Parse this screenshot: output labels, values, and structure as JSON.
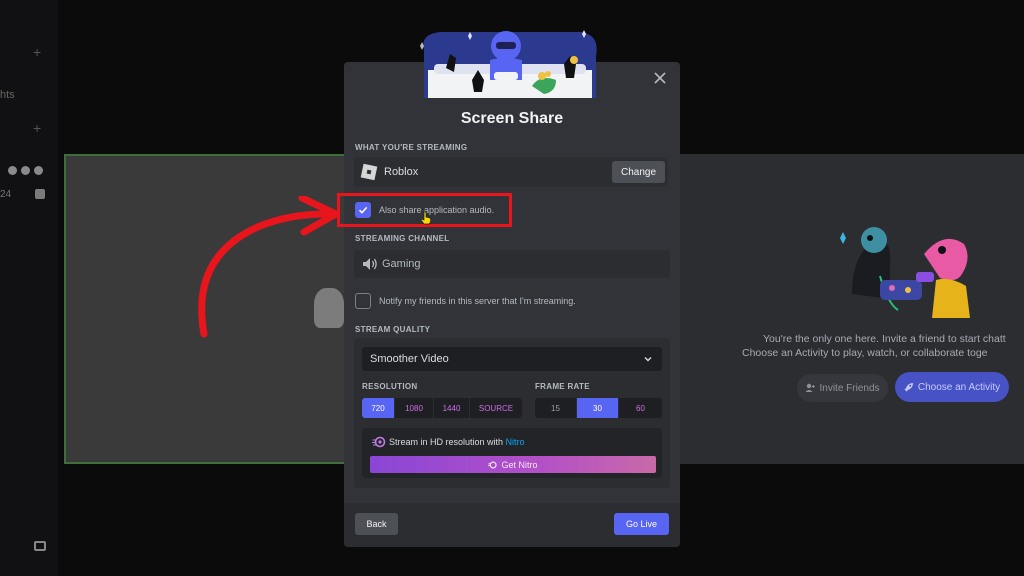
{
  "sidebar": {
    "partial_text": "hts",
    "partial_number": "24"
  },
  "background": {
    "empty_line1": "You're the only one here. Invite a friend to start chatt",
    "empty_line2": "Choose an Activity to play, watch, or collaborate toge",
    "invite_label": "Invite Friends",
    "activity_label": "Choose an Activity"
  },
  "modal": {
    "title": "Screen Share",
    "close_icon": "close-icon",
    "streaming_section": "WHAT YOU'RE STREAMING",
    "source_name": "Roblox",
    "change_label": "Change",
    "share_audio_label": "Also share application audio.",
    "share_audio_checked": true,
    "channel_section": "STREAMING CHANNEL",
    "channel_name": "Gaming",
    "notify_label": "Notify my friends in this server that I'm streaming.",
    "notify_checked": false,
    "quality_section": "STREAM QUALITY",
    "quality_selected": "Smoother Video",
    "resolution_label": "RESOLUTION",
    "resolutions": [
      "720",
      "1080",
      "1440",
      "SOURCE"
    ],
    "resolution_selected": "720",
    "framerate_label": "FRAME RATE",
    "framerates": [
      "15",
      "30",
      "60"
    ],
    "framerate_selected": "30",
    "nitro_text": "Stream in HD resolution with ",
    "nitro_link": "Nitro",
    "get_nitro_label": "Get Nitro",
    "back_label": "Back",
    "golive_label": "Go Live"
  },
  "colors": {
    "accent": "#5865f2",
    "highlight": "#e8151c",
    "nitro_gradient_start": "#8a46d6",
    "nitro_gradient_end": "#c86aa8"
  }
}
